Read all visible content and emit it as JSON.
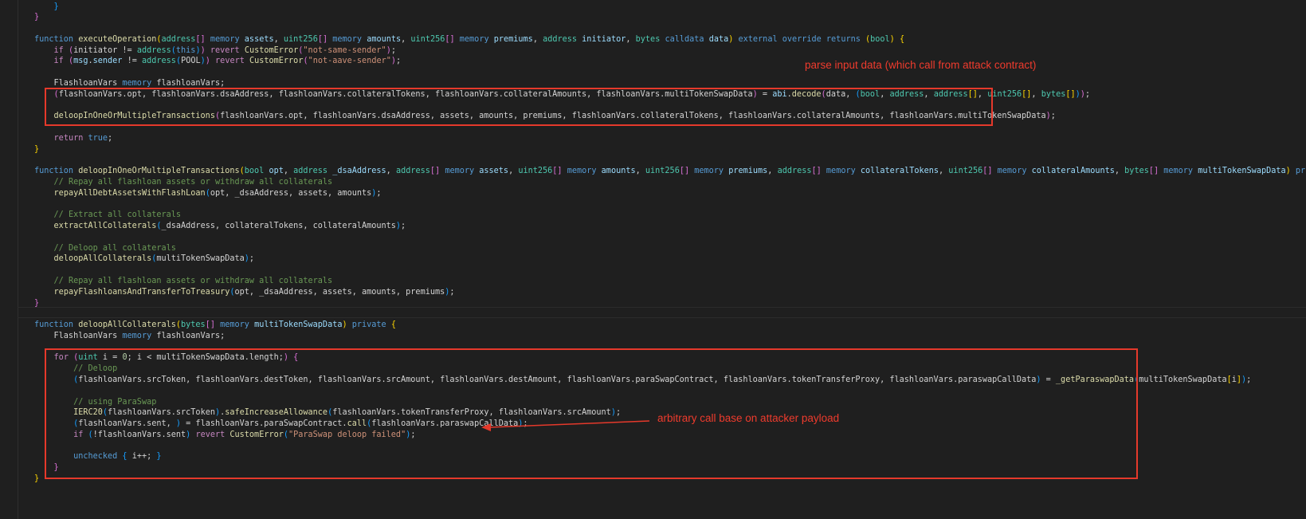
{
  "editor": {
    "theme_colors": {
      "background": "#1f1f1f",
      "keyword": "#569cd6",
      "control": "#c586c0",
      "function": "#dcdcaa",
      "variable": "#9cdcfe",
      "type": "#4ec9b0",
      "string": "#ce9178",
      "number": "#b5cea8",
      "comment": "#6a9955",
      "annotation": "#e5392b"
    },
    "lines": [
      [
        [
          "p3",
          "    }"
        ]
      ],
      [
        [
          "p2",
          "}"
        ]
      ],
      [],
      [
        [
          "kw",
          "function "
        ],
        [
          "fn",
          "executeOperation"
        ],
        [
          "p1",
          "("
        ],
        [
          "ty",
          "address"
        ],
        [
          "p2",
          "[]"
        ],
        [
          "pl",
          " "
        ],
        [
          "kw",
          "memory"
        ],
        [
          "pl",
          " "
        ],
        [
          "var",
          "assets"
        ],
        [
          "pl",
          ", "
        ],
        [
          "ty",
          "uint256"
        ],
        [
          "p2",
          "[]"
        ],
        [
          "pl",
          " "
        ],
        [
          "kw",
          "memory"
        ],
        [
          "pl",
          " "
        ],
        [
          "var",
          "amounts"
        ],
        [
          "pl",
          ", "
        ],
        [
          "ty",
          "uint256"
        ],
        [
          "p2",
          "[]"
        ],
        [
          "pl",
          " "
        ],
        [
          "kw",
          "memory"
        ],
        [
          "pl",
          " "
        ],
        [
          "var",
          "premiums"
        ],
        [
          "pl",
          ", "
        ],
        [
          "ty",
          "address"
        ],
        [
          "pl",
          " "
        ],
        [
          "var",
          "initiator"
        ],
        [
          "pl",
          ", "
        ],
        [
          "ty",
          "bytes"
        ],
        [
          "pl",
          " "
        ],
        [
          "kw",
          "calldata"
        ],
        [
          "pl",
          " "
        ],
        [
          "var",
          "data"
        ],
        [
          "p1",
          ")"
        ],
        [
          "pl",
          " "
        ],
        [
          "kw",
          "external override returns "
        ],
        [
          "p1",
          "("
        ],
        [
          "ty",
          "bool"
        ],
        [
          "p1",
          ")"
        ],
        [
          "pl",
          " "
        ],
        [
          "p1",
          "{"
        ]
      ],
      [
        [
          "pl",
          "    "
        ],
        [
          "ctl",
          "if "
        ],
        [
          "p2",
          "("
        ],
        [
          "pl",
          "initiator != "
        ],
        [
          "ty",
          "address"
        ],
        [
          "p3",
          "("
        ],
        [
          "kw",
          "this"
        ],
        [
          "p3",
          ")"
        ],
        [
          "p2",
          ")"
        ],
        [
          "pl",
          " "
        ],
        [
          "ctl",
          "revert "
        ],
        [
          "fn",
          "CustomError"
        ],
        [
          "p2",
          "("
        ],
        [
          "str",
          "\"not-same-sender\""
        ],
        [
          "p2",
          ")"
        ],
        [
          "pl",
          ";"
        ]
      ],
      [
        [
          "pl",
          "    "
        ],
        [
          "ctl",
          "if "
        ],
        [
          "p2",
          "("
        ],
        [
          "var",
          "msg"
        ],
        [
          "pl",
          "."
        ],
        [
          "var",
          "sender"
        ],
        [
          "pl",
          " != "
        ],
        [
          "ty",
          "address"
        ],
        [
          "p3",
          "("
        ],
        [
          "pl",
          "POOL"
        ],
        [
          "p3",
          ")"
        ],
        [
          "p2",
          ")"
        ],
        [
          "pl",
          " "
        ],
        [
          "ctl",
          "revert "
        ],
        [
          "fn",
          "CustomError"
        ],
        [
          "p2",
          "("
        ],
        [
          "str",
          "\"not-aave-sender\""
        ],
        [
          "p2",
          ")"
        ],
        [
          "pl",
          ";"
        ]
      ],
      [],
      [
        [
          "pl",
          "    FlashloanVars "
        ],
        [
          "kw",
          "memory"
        ],
        [
          "pl",
          " flashloanVars;"
        ]
      ],
      [
        [
          "pl",
          "    "
        ],
        [
          "p2",
          "("
        ],
        [
          "pl",
          "flashloanVars.opt, flashloanVars.dsaAddress, flashloanVars.collateralTokens, flashloanVars.collateralAmounts, flashloanVars.multiTokenSwapData"
        ],
        [
          "p2",
          ")"
        ],
        [
          "pl",
          " = "
        ],
        [
          "var",
          "abi"
        ],
        [
          "pl",
          "."
        ],
        [
          "fn",
          "decode"
        ],
        [
          "p2",
          "("
        ],
        [
          "pl",
          "data, "
        ],
        [
          "p3",
          "("
        ],
        [
          "ty",
          "bool"
        ],
        [
          "pl",
          ", "
        ],
        [
          "ty",
          "address"
        ],
        [
          "pl",
          ", "
        ],
        [
          "ty",
          "address"
        ],
        [
          "p1",
          "[]"
        ],
        [
          "pl",
          ", "
        ],
        [
          "ty",
          "uint256"
        ],
        [
          "p1",
          "[]"
        ],
        [
          "pl",
          ", "
        ],
        [
          "ty",
          "bytes"
        ],
        [
          "p1",
          "[]"
        ],
        [
          "p3",
          ")"
        ],
        [
          "p2",
          ")"
        ],
        [
          "pl",
          ";"
        ]
      ],
      [],
      [
        [
          "pl",
          "    "
        ],
        [
          "fn",
          "deloopInOneOrMultipleTransactions"
        ],
        [
          "p2",
          "("
        ],
        [
          "pl",
          "flashloanVars.opt, flashloanVars.dsaAddress, assets, amounts, premiums, flashloanVars.collateralTokens, flashloanVars.collateralAmounts, flashloanVars.multiTokenSwapData"
        ],
        [
          "p2",
          ")"
        ],
        [
          "pl",
          ";"
        ]
      ],
      [],
      [
        [
          "pl",
          "    "
        ],
        [
          "ctl",
          "return "
        ],
        [
          "kw",
          "true"
        ],
        [
          "pl",
          ";"
        ]
      ],
      [
        [
          "p1",
          "}"
        ]
      ],
      [],
      [
        [
          "kw",
          "function "
        ],
        [
          "fn",
          "deloopInOneOrMultipleTransactions"
        ],
        [
          "p1",
          "("
        ],
        [
          "ty",
          "bool"
        ],
        [
          "pl",
          " "
        ],
        [
          "var",
          "opt"
        ],
        [
          "pl",
          ", "
        ],
        [
          "ty",
          "address"
        ],
        [
          "pl",
          " "
        ],
        [
          "var",
          "_dsaAddress"
        ],
        [
          "pl",
          ", "
        ],
        [
          "ty",
          "address"
        ],
        [
          "p2",
          "[]"
        ],
        [
          "pl",
          " "
        ],
        [
          "kw",
          "memory"
        ],
        [
          "pl",
          " "
        ],
        [
          "var",
          "assets"
        ],
        [
          "pl",
          ", "
        ],
        [
          "ty",
          "uint256"
        ],
        [
          "p2",
          "[]"
        ],
        [
          "pl",
          " "
        ],
        [
          "kw",
          "memory"
        ],
        [
          "pl",
          " "
        ],
        [
          "var",
          "amounts"
        ],
        [
          "pl",
          ", "
        ],
        [
          "ty",
          "uint256"
        ],
        [
          "p2",
          "[]"
        ],
        [
          "pl",
          " "
        ],
        [
          "kw",
          "memory"
        ],
        [
          "pl",
          " "
        ],
        [
          "var",
          "premiums"
        ],
        [
          "pl",
          ", "
        ],
        [
          "ty",
          "address"
        ],
        [
          "p2",
          "[]"
        ],
        [
          "pl",
          " "
        ],
        [
          "kw",
          "memory"
        ],
        [
          "pl",
          " "
        ],
        [
          "var",
          "collateralTokens"
        ],
        [
          "pl",
          ", "
        ],
        [
          "ty",
          "uint256"
        ],
        [
          "p2",
          "[]"
        ],
        [
          "pl",
          " "
        ],
        [
          "kw",
          "memory"
        ],
        [
          "pl",
          " "
        ],
        [
          "var",
          "collateralAmounts"
        ],
        [
          "pl",
          ", "
        ],
        [
          "ty",
          "bytes"
        ],
        [
          "p2",
          "[]"
        ],
        [
          "pl",
          " "
        ],
        [
          "kw",
          "memory"
        ],
        [
          "pl",
          " "
        ],
        [
          "var",
          "multiTokenSwapData"
        ],
        [
          "p1",
          ")"
        ],
        [
          "pl",
          " "
        ],
        [
          "kw",
          "private "
        ],
        [
          "p2",
          "{"
        ]
      ],
      [
        [
          "pl",
          "    "
        ],
        [
          "cm",
          "// Repay all flashloan assets or withdraw all collaterals"
        ]
      ],
      [
        [
          "pl",
          "    "
        ],
        [
          "fn",
          "repayAllDebtAssetsWithFlashLoan"
        ],
        [
          "p3",
          "("
        ],
        [
          "pl",
          "opt, _dsaAddress, assets, amounts"
        ],
        [
          "p3",
          ")"
        ],
        [
          "pl",
          ";"
        ]
      ],
      [],
      [
        [
          "pl",
          "    "
        ],
        [
          "cm",
          "// Extract all collaterals"
        ]
      ],
      [
        [
          "pl",
          "    "
        ],
        [
          "fn",
          "extractAllCollaterals"
        ],
        [
          "p3",
          "("
        ],
        [
          "pl",
          "_dsaAddress, collateralTokens, collateralAmounts"
        ],
        [
          "p3",
          ")"
        ],
        [
          "pl",
          ";"
        ]
      ],
      [],
      [
        [
          "pl",
          "    "
        ],
        [
          "cm",
          "// Deloop all collaterals"
        ]
      ],
      [
        [
          "pl",
          "    "
        ],
        [
          "fn",
          "deloopAllCollaterals"
        ],
        [
          "p3",
          "("
        ],
        [
          "pl",
          "multiTokenSwapData"
        ],
        [
          "p3",
          ")"
        ],
        [
          "pl",
          ";"
        ]
      ],
      [],
      [
        [
          "pl",
          "    "
        ],
        [
          "cm",
          "// Repay all flashloan assets or withdraw all collaterals"
        ]
      ],
      [
        [
          "pl",
          "    "
        ],
        [
          "fn",
          "repayFlashloansAndTransferToTreasury"
        ],
        [
          "p3",
          "("
        ],
        [
          "pl",
          "opt, _dsaAddress, assets, amounts, premiums"
        ],
        [
          "p3",
          ")"
        ],
        [
          "pl",
          ";"
        ]
      ],
      [
        [
          "p2",
          "}"
        ]
      ],
      [],
      [
        [
          "kw",
          "function "
        ],
        [
          "fn",
          "deloopAllCollaterals"
        ],
        [
          "p1",
          "("
        ],
        [
          "ty",
          "bytes"
        ],
        [
          "p2",
          "[]"
        ],
        [
          "pl",
          " "
        ],
        [
          "kw",
          "memory"
        ],
        [
          "pl",
          " "
        ],
        [
          "var",
          "multiTokenSwapData"
        ],
        [
          "p1",
          ")"
        ],
        [
          "pl",
          " "
        ],
        [
          "kw",
          "private "
        ],
        [
          "p1",
          "{"
        ]
      ],
      [
        [
          "pl",
          "    FlashloanVars "
        ],
        [
          "kw",
          "memory"
        ],
        [
          "pl",
          " flashloanVars;"
        ]
      ],
      [],
      [
        [
          "pl",
          "    "
        ],
        [
          "ctl",
          "for "
        ],
        [
          "p2",
          "("
        ],
        [
          "ty",
          "uint"
        ],
        [
          "pl",
          " i = "
        ],
        [
          "num",
          "0"
        ],
        [
          "pl",
          "; i < multiTokenSwapData.length;"
        ],
        [
          "p2",
          ")"
        ],
        [
          "pl",
          " "
        ],
        [
          "p2",
          "{"
        ]
      ],
      [
        [
          "pl",
          "        "
        ],
        [
          "cm",
          "// Deloop"
        ]
      ],
      [
        [
          "pl",
          "        "
        ],
        [
          "p3",
          "("
        ],
        [
          "pl",
          "flashloanVars.srcToken, flashloanVars.destToken, flashloanVars.srcAmount, flashloanVars.destAmount, flashloanVars.paraSwapContract, flashloanVars.tokenTransferProxy, flashloanVars.paraswapCallData"
        ],
        [
          "p3",
          ")"
        ],
        [
          "pl",
          " = "
        ],
        [
          "fn",
          "_getParaswapData"
        ],
        [
          "p3",
          "("
        ],
        [
          "pl",
          "multiTokenSwapData"
        ],
        [
          "p1",
          "["
        ],
        [
          "pl",
          "i"
        ],
        [
          "p1",
          "]"
        ],
        [
          "p3",
          ")"
        ],
        [
          "pl",
          ";"
        ]
      ],
      [],
      [
        [
          "pl",
          "        "
        ],
        [
          "cm",
          "// using ParaSwap"
        ]
      ],
      [
        [
          "pl",
          "        "
        ],
        [
          "fn",
          "IERC20"
        ],
        [
          "p3",
          "("
        ],
        [
          "pl",
          "flashloanVars.srcToken"
        ],
        [
          "p3",
          ")"
        ],
        [
          "pl",
          "."
        ],
        [
          "fn",
          "safeIncreaseAllowance"
        ],
        [
          "p3",
          "("
        ],
        [
          "pl",
          "flashloanVars.tokenTransferProxy, flashloanVars.srcAmount"
        ],
        [
          "p3",
          ")"
        ],
        [
          "pl",
          ";"
        ]
      ],
      [
        [
          "pl",
          "        "
        ],
        [
          "p3",
          "("
        ],
        [
          "pl",
          "flashloanVars.sent, "
        ],
        [
          "p3",
          ")"
        ],
        [
          "pl",
          " = flashloanVars.paraSwapContract."
        ],
        [
          "fn",
          "call"
        ],
        [
          "p3",
          "("
        ],
        [
          "pl",
          "flashloanVars.paraswapCallData"
        ],
        [
          "p3",
          ")"
        ],
        [
          "pl",
          ";"
        ]
      ],
      [
        [
          "pl",
          "        "
        ],
        [
          "ctl",
          "if "
        ],
        [
          "p3",
          "("
        ],
        [
          "pl",
          "!flashloanVars.sent"
        ],
        [
          "p3",
          ")"
        ],
        [
          "pl",
          " "
        ],
        [
          "ctl",
          "revert "
        ],
        [
          "fn",
          "CustomError"
        ],
        [
          "p3",
          "("
        ],
        [
          "str",
          "\"ParaSwap deloop failed\""
        ],
        [
          "p3",
          ")"
        ],
        [
          "pl",
          ";"
        ]
      ],
      [],
      [
        [
          "pl",
          "        "
        ],
        [
          "kw",
          "unchecked "
        ],
        [
          "p3",
          "{"
        ],
        [
          "pl",
          " i++; "
        ],
        [
          "p3",
          "}"
        ]
      ],
      [
        [
          "pl",
          "    "
        ],
        [
          "p2",
          "}"
        ]
      ],
      [
        [
          "p1",
          "}"
        ]
      ]
    ]
  },
  "annotations": {
    "parse_note": "parse input data (which call from attack contract)",
    "call_note": "arbitrary call base on attacker payload"
  }
}
